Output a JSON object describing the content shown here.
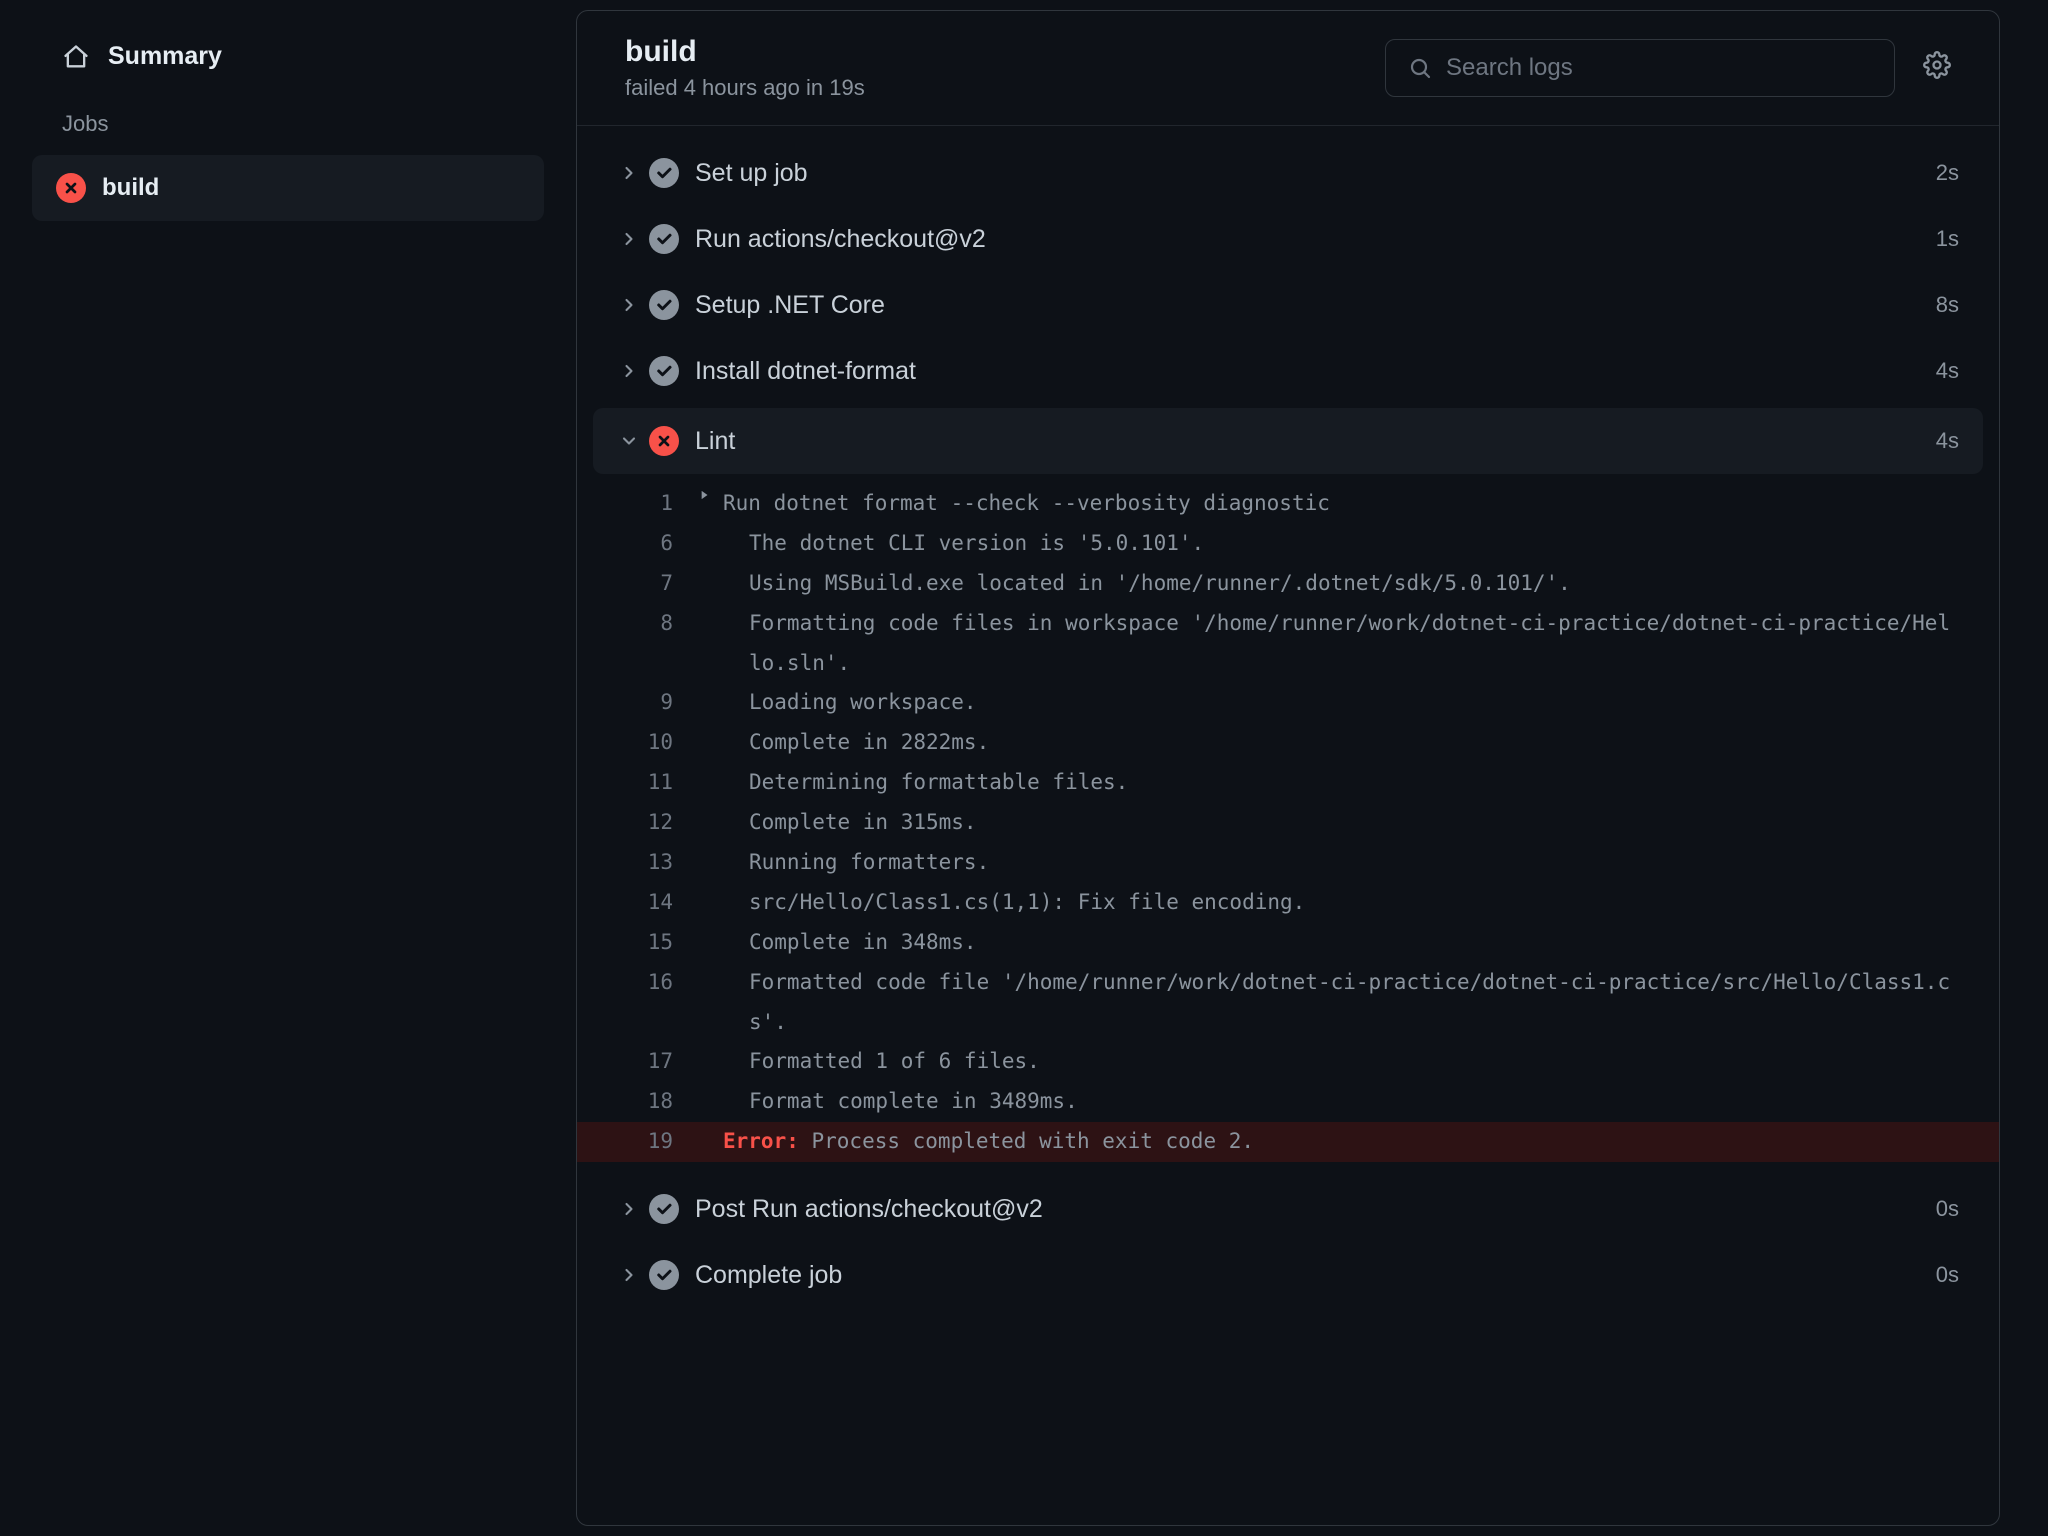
{
  "sidebar": {
    "summary_label": "Summary",
    "jobs_label": "Jobs",
    "job_name": "build"
  },
  "header": {
    "title": "build",
    "subtitle": "failed 4 hours ago in 19s",
    "search_placeholder": "Search logs"
  },
  "steps": [
    {
      "name": "Set up job",
      "status": "success",
      "expanded": false,
      "duration": "2s"
    },
    {
      "name": "Run actions/checkout@v2",
      "status": "success",
      "expanded": false,
      "duration": "1s"
    },
    {
      "name": "Setup .NET Core",
      "status": "success",
      "expanded": false,
      "duration": "8s"
    },
    {
      "name": "Install dotnet-format",
      "status": "success",
      "expanded": false,
      "duration": "4s"
    },
    {
      "name": "Lint",
      "status": "fail",
      "expanded": true,
      "duration": "4s"
    },
    {
      "name": "Post Run actions/checkout@v2",
      "status": "success",
      "expanded": false,
      "duration": "0s"
    },
    {
      "name": "Complete job",
      "status": "success",
      "expanded": false,
      "duration": "0s"
    }
  ],
  "log": {
    "error_label": "Error:",
    "lines": [
      {
        "n": 1,
        "caret": true,
        "indent": false,
        "text": "Run dotnet format --check --verbosity diagnostic"
      },
      {
        "n": 6,
        "caret": false,
        "indent": true,
        "text": "The dotnet CLI version is '5.0.101'."
      },
      {
        "n": 7,
        "caret": false,
        "indent": true,
        "text": "Using MSBuild.exe located in '/home/runner/.dotnet/sdk/5.0.101/'."
      },
      {
        "n": 8,
        "caret": false,
        "indent": true,
        "text": "Formatting code files in workspace '/home/runner/work/dotnet-ci-practice/dotnet-ci-practice/Hello.sln'."
      },
      {
        "n": 9,
        "caret": false,
        "indent": true,
        "text": "Loading workspace."
      },
      {
        "n": 10,
        "caret": false,
        "indent": true,
        "text": "Complete in 2822ms."
      },
      {
        "n": 11,
        "caret": false,
        "indent": true,
        "text": "Determining formattable files."
      },
      {
        "n": 12,
        "caret": false,
        "indent": true,
        "text": "Complete in 315ms."
      },
      {
        "n": 13,
        "caret": false,
        "indent": true,
        "text": "Running formatters."
      },
      {
        "n": 14,
        "caret": false,
        "indent": true,
        "text": "src/Hello/Class1.cs(1,1): Fix file encoding."
      },
      {
        "n": 15,
        "caret": false,
        "indent": true,
        "text": "Complete in 348ms."
      },
      {
        "n": 16,
        "caret": false,
        "indent": true,
        "text": "Formatted code file '/home/runner/work/dotnet-ci-practice/dotnet-ci-practice/src/Hello/Class1.cs'."
      },
      {
        "n": 17,
        "caret": false,
        "indent": true,
        "text": "Formatted 1 of 6 files."
      },
      {
        "n": 18,
        "caret": false,
        "indent": true,
        "text": "Format complete in 3489ms."
      },
      {
        "n": 19,
        "caret": false,
        "indent": false,
        "error": true,
        "text": " Process completed with exit code 2."
      }
    ]
  }
}
